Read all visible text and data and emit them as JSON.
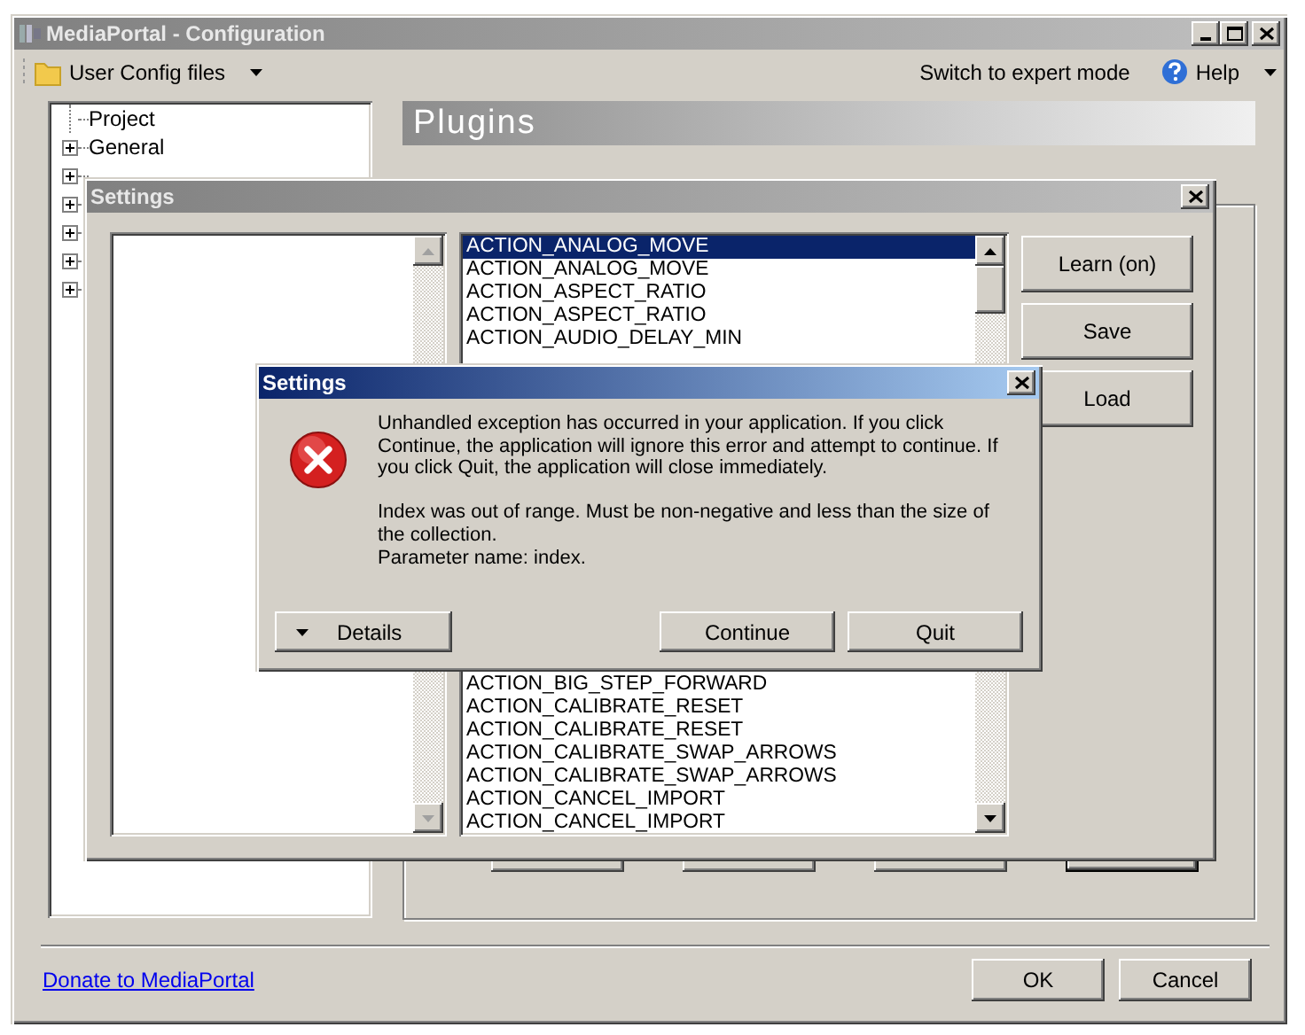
{
  "main_window": {
    "title": "MediaPortal - Configuration",
    "active": false
  },
  "toolbar": {
    "config_menu": "User Config files",
    "expert_mode": "Switch to expert mode",
    "help": "Help"
  },
  "tree": [
    {
      "label": "Project",
      "kind": "leaf"
    },
    {
      "label": "General",
      "kind": "node",
      "expanded": false
    },
    {
      "kind": "node",
      "expanded": false
    },
    {
      "kind": "node",
      "expanded": false
    },
    {
      "kind": "node",
      "expanded": false
    },
    {
      "kind": "node",
      "expanded": false
    },
    {
      "kind": "node",
      "expanded": false
    }
  ],
  "section_title": "Plugins",
  "footer": {
    "link": "Donate to MediaPortal",
    "buttons": [
      "OK",
      "Cancel"
    ]
  },
  "settings_window": {
    "title": "Settings",
    "active": false,
    "actions": [
      "Learn (on)",
      "Save",
      "Load"
    ],
    "list_top": [
      {
        "label": "ACTION_ANALOG_MOVE",
        "selected": true
      },
      {
        "label": "ACTION_ANALOG_MOVE",
        "selected": false
      },
      {
        "label": "ACTION_ASPECT_RATIO",
        "selected": false
      },
      {
        "label": "ACTION_ASPECT_RATIO",
        "selected": false
      },
      {
        "label": "ACTION_AUDIO_DELAY_MIN",
        "selected": false
      }
    ],
    "list_bottom": [
      {
        "label": "ACTION_BIG_STEP_FORWARD",
        "selected": false
      },
      {
        "label": "ACTION_CALIBRATE_RESET",
        "selected": false
      },
      {
        "label": "ACTION_CALIBRATE_RESET",
        "selected": false
      },
      {
        "label": "ACTION_CALIBRATE_SWAP_ARROWS",
        "selected": false
      },
      {
        "label": "ACTION_CALIBRATE_SWAP_ARROWS",
        "selected": false
      },
      {
        "label": "ACTION_CANCEL_IMPORT",
        "selected": false
      },
      {
        "label": "ACTION_CANCEL_IMPORT",
        "selected": false
      }
    ]
  },
  "error_dialog": {
    "title": "Settings",
    "active": true,
    "message": [
      "Unhandled exception has occurred in your application. If you click Continue, the application will ignore this error and attempt to continue. If you click Quit, the application will close immediately.",
      "Index was out of range. Must be non-negative and less than the size of the collection.",
      "Parameter name: index."
    ],
    "details": "Details",
    "buttons": [
      "Continue",
      "Quit"
    ]
  }
}
